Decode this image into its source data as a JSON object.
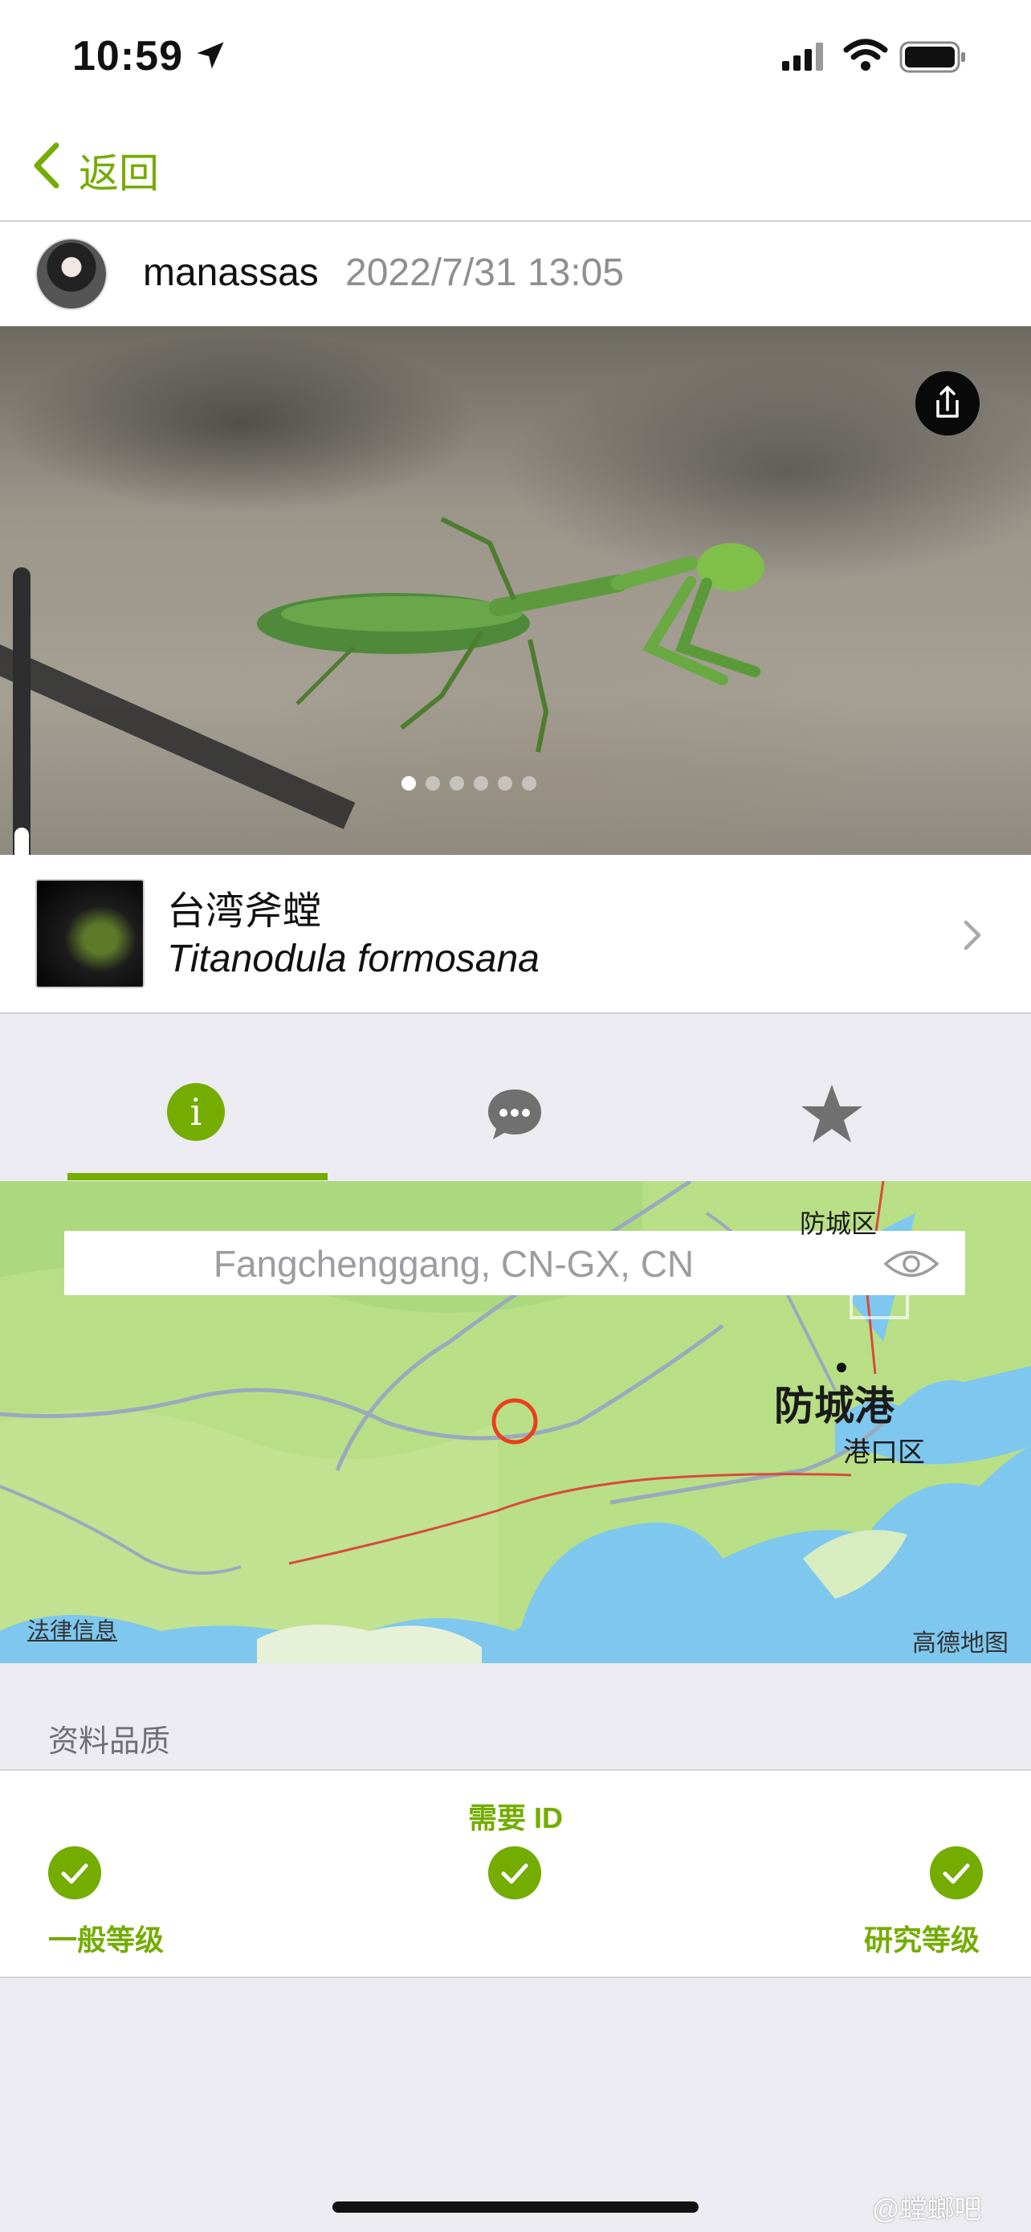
{
  "status_bar": {
    "time": "10:59"
  },
  "nav": {
    "back_label": "返回"
  },
  "observation": {
    "username": "manassas",
    "datetime": "2022/7/31 13:05",
    "photo_count": 6,
    "active_photo_index": 0
  },
  "taxon": {
    "common_name": "台湾斧螳",
    "scientific_name": "Titanodula formosana"
  },
  "tabs": [
    {
      "name": "info",
      "icon": "info-icon",
      "active": true,
      "glyph": "i"
    },
    {
      "name": "comments",
      "icon": "speech-bubble-icon",
      "active": false
    },
    {
      "name": "favorites",
      "icon": "star-icon",
      "active": false
    }
  ],
  "map": {
    "place_guess": "Fangchenggang, CN-GX, CN",
    "city_label": "防城港",
    "district_label": "港口区",
    "district_top_label": "防城区",
    "legal_link": "法律信息",
    "provider": "高德地图"
  },
  "quality": {
    "section_title": "资料品质",
    "needs_id_label": "需要 ID",
    "casual_label": "一般等级",
    "research_label": "研究等级"
  },
  "watermark": "@螳螂吧",
  "colors": {
    "accent": "#74ac00",
    "background": "#ecebf1",
    "marker": "#e8401c"
  }
}
